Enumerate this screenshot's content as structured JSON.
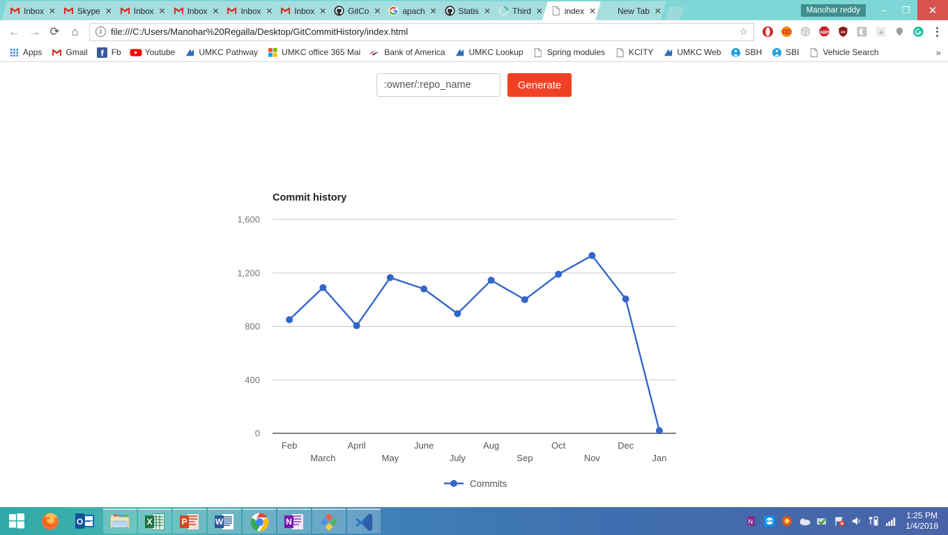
{
  "browser": {
    "tabs": [
      {
        "label": "Inbox",
        "icon": "gmail-icon",
        "active": false
      },
      {
        "label": "Skype",
        "icon": "gmail-icon",
        "active": false
      },
      {
        "label": "Inbox",
        "icon": "gmail-icon",
        "active": false
      },
      {
        "label": "Inbox",
        "icon": "gmail-icon",
        "active": false
      },
      {
        "label": "Inbox",
        "icon": "gmail-icon",
        "active": false
      },
      {
        "label": "Inbox",
        "icon": "gmail-icon",
        "active": false
      },
      {
        "label": "GitCo",
        "icon": "github-icon",
        "active": false
      },
      {
        "label": "apach",
        "icon": "google-icon",
        "active": false
      },
      {
        "label": "Statis",
        "icon": "github-icon",
        "active": false
      },
      {
        "label": "Third",
        "icon": "loading-spinner-icon",
        "active": false
      },
      {
        "label": "index",
        "icon": "page-icon",
        "active": true
      },
      {
        "label": "New Tab",
        "icon": "none",
        "active": false
      }
    ],
    "tab_close_label": "✕",
    "user_chip": "Manohar reddy",
    "window_controls": {
      "minimize": "–",
      "maximize": "❐",
      "close": "✕"
    },
    "toolbar": {
      "back": "←",
      "forward": "→",
      "reload": "⟳",
      "home": "⌂",
      "url": "file:///C:/Users/Manohar%20Regalla/Desktop/GitCommitHistory/index.html",
      "info_icon_glyph": "i",
      "star": "☆",
      "extensions": [
        {
          "name": "opera-extension-icon",
          "color": "#cf1f1f"
        },
        {
          "name": "infinity-extension-icon",
          "color": "#f08c00"
        },
        {
          "name": "cube-extension-icon",
          "color": "#bdbdbd"
        },
        {
          "name": "adblock-plus-icon",
          "color": "#c9202a"
        },
        {
          "name": "ublock-origin-icon",
          "color": "#8b1a1a"
        },
        {
          "name": "grey-square-extension-icon",
          "color": "#c4c4c4"
        },
        {
          "name": "pdf-extension-icon",
          "color": "#b8b8b8"
        },
        {
          "name": "balloon-extension-icon",
          "color": "#9e9e9e"
        },
        {
          "name": "grammarly-icon",
          "color": "#15c39a"
        }
      ]
    },
    "bookmarks": [
      {
        "label": "Apps",
        "icon": "apps-grid-icon"
      },
      {
        "label": "Gmail",
        "icon": "gmail-icon"
      },
      {
        "label": "Fb",
        "icon": "facebook-icon"
      },
      {
        "label": "Youtube",
        "icon": "youtube-icon"
      },
      {
        "label": "UMKC Pathway",
        "icon": "umkc-icon"
      },
      {
        "label": "UMKC office 365 Mai",
        "icon": "microsoft-icon"
      },
      {
        "label": "Bank of America",
        "icon": "bofa-icon"
      },
      {
        "label": "UMKC Lookup",
        "icon": "umkc-icon"
      },
      {
        "label": "Spring modules",
        "icon": "page-icon"
      },
      {
        "label": "KCITY",
        "icon": "page-icon"
      },
      {
        "label": "UMKC Web",
        "icon": "umkc-icon"
      },
      {
        "label": "SBH",
        "icon": "sbi-icon"
      },
      {
        "label": "SBI",
        "icon": "sbi-icon"
      },
      {
        "label": "Vehicle Search",
        "icon": "page-icon"
      }
    ],
    "bookmarks_overflow": "»"
  },
  "page": {
    "repo_input_value": "",
    "repo_input_placeholder": ":owner/:repo_name",
    "generate_label": "Generate"
  },
  "chart_data": {
    "type": "line",
    "title": "Commit history",
    "xlabel": "",
    "ylabel": "",
    "categories": [
      "Feb",
      "March",
      "April",
      "May",
      "June",
      "July",
      "Aug",
      "Sep",
      "Oct",
      "Nov",
      "Dec",
      "Jan"
    ],
    "series": [
      {
        "name": "Commits",
        "values": [
          850,
          1090,
          805,
          1165,
          1080,
          895,
          1145,
          1000,
          1190,
          1330,
          1005,
          20
        ]
      }
    ],
    "ylim": [
      0,
      1600
    ],
    "yticks": [
      0,
      400,
      800,
      1200,
      1600
    ],
    "ytick_labels": [
      "0",
      "400",
      "800",
      "1,200",
      "1,600"
    ],
    "grid": true,
    "legend_position": "bottom",
    "legend_entries": [
      "Commits"
    ],
    "series_color": "#3366cc",
    "point_radius": 5
  },
  "taskbar": {
    "start": "windows-start-icon",
    "items": [
      {
        "name": "firefox-taskbar-icon",
        "open": false
      },
      {
        "name": "outlook-taskbar-icon",
        "open": false
      },
      {
        "name": "file-explorer-taskbar-icon",
        "open": true
      },
      {
        "name": "excel-taskbar-icon",
        "open": true
      },
      {
        "name": "powerpoint-taskbar-icon",
        "open": true
      },
      {
        "name": "word-taskbar-icon",
        "open": true
      },
      {
        "name": "chrome-taskbar-icon",
        "open": true
      },
      {
        "name": "onenote-taskbar-icon",
        "open": true
      },
      {
        "name": "photos-taskbar-icon",
        "open": true
      },
      {
        "name": "vscode-taskbar-icon",
        "open": true
      }
    ],
    "tray": [
      {
        "name": "onenote-clipper-tray-icon"
      },
      {
        "name": "teamviewer-tray-icon"
      },
      {
        "name": "antivirus-tray-icon"
      },
      {
        "name": "onedrive-tray-icon"
      },
      {
        "name": "safe-tray-icon"
      },
      {
        "name": "network-error-tray-icon"
      },
      {
        "name": "volume-tray-icon"
      },
      {
        "name": "battery-tray-icon"
      },
      {
        "name": "signal-tray-icon"
      }
    ],
    "clock_time": "1:25 PM",
    "clock_date": "1/4/2018"
  }
}
